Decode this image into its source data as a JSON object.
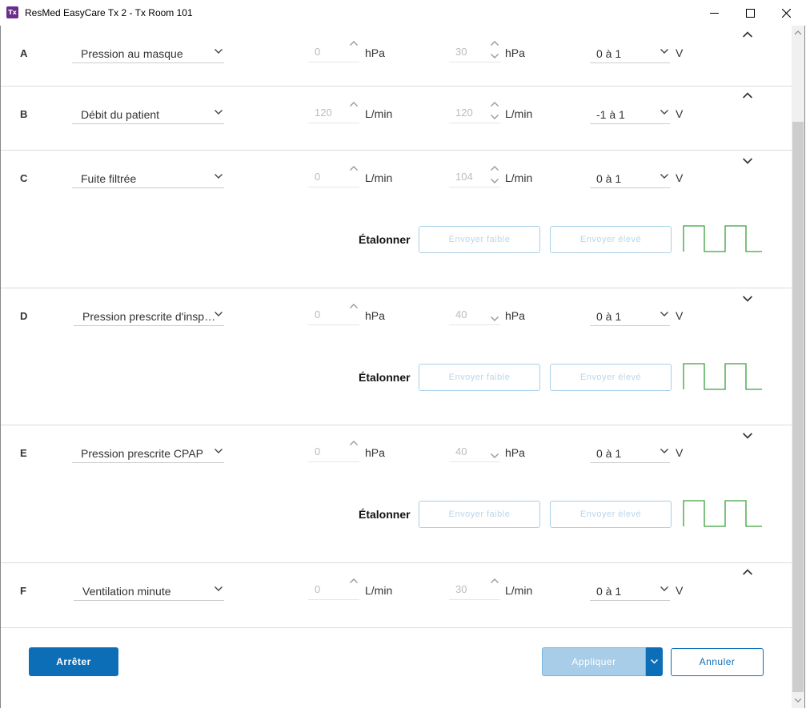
{
  "window": {
    "app_icon_text": "Tx",
    "title": "ResMed EasyCare Tx 2 - Tx Room 101"
  },
  "channels": [
    {
      "letter": "A",
      "signal": "Pression au masque",
      "min": "0",
      "min_unit": "hPa",
      "max": "30",
      "max_unit": "hPa",
      "range": "0 à 1",
      "volt_unit": "V",
      "expanded": false
    },
    {
      "letter": "B",
      "signal": "Débit du patient",
      "min": "120",
      "min_unit": "L/min",
      "max": "120",
      "max_unit": "L/min",
      "range": "-1 à 1",
      "volt_unit": "V",
      "expanded": false
    },
    {
      "letter": "C",
      "signal": "Fuite filtrée",
      "min": "0",
      "min_unit": "L/min",
      "max": "104",
      "max_unit": "L/min",
      "range": "0 à 1",
      "volt_unit": "V",
      "expanded": true,
      "calibrate_label": "Étalonner",
      "send_low": "Envoyer faible",
      "send_high": "Envoyer élevé"
    },
    {
      "letter": "D",
      "signal": "Pression prescrite d'insp…",
      "min": "0",
      "min_unit": "hPa",
      "max": "40",
      "max_unit": "hPa",
      "range": "0 à 1",
      "volt_unit": "V",
      "expanded": true,
      "calibrate_label": "Étalonner",
      "send_low": "Envoyer faible",
      "send_high": "Envoyer élevé"
    },
    {
      "letter": "E",
      "signal": "Pression prescrite CPAP",
      "min": "0",
      "min_unit": "hPa",
      "max": "40",
      "max_unit": "hPa",
      "range": "0 à 1",
      "volt_unit": "V",
      "expanded": true,
      "calibrate_label": "Étalonner",
      "send_low": "Envoyer faible",
      "send_high": "Envoyer élevé"
    },
    {
      "letter": "F",
      "signal": "Ventilation minute",
      "min": "0",
      "min_unit": "L/min",
      "max": "30",
      "max_unit": "L/min",
      "range": "0 à 1",
      "volt_unit": "V",
      "expanded": false
    }
  ],
  "footer": {
    "stop": "Arrêter",
    "apply": "Appliquer",
    "cancel": "Annuler"
  },
  "colors": {
    "primary": "#0d6eb8",
    "apply_disabled": "#a7cde8",
    "wave": "#3aa03a",
    "app_icon": "#6b2d8c"
  }
}
